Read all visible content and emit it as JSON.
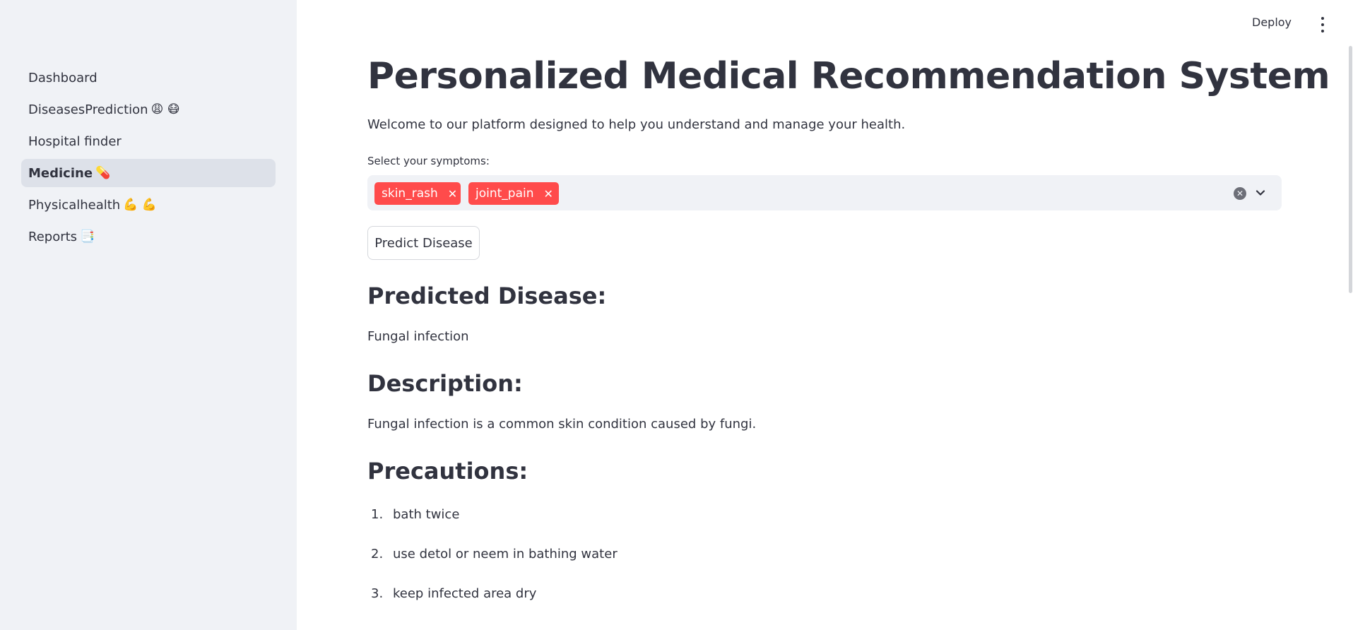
{
  "sidebar": {
    "items": [
      {
        "label": "Dashboard",
        "emoji": ""
      },
      {
        "label": "DiseasesPrediction",
        "emoji": "😩 😷"
      },
      {
        "label": "Hospital finder",
        "emoji": ""
      },
      {
        "label": "Medicine",
        "emoji": "💊"
      },
      {
        "label": "Physicalhealth",
        "emoji": "💪 💪"
      },
      {
        "label": "Reports",
        "emoji": "📑"
      }
    ],
    "active_index": 3
  },
  "header": {
    "deploy_label": "Deploy"
  },
  "main": {
    "title": "Personalized Medical Recommendation System",
    "welcome": "Welcome to our platform designed to help you understand and manage your health.",
    "select_label": "Select your symptoms:",
    "selected_symptoms": [
      "skin_rash",
      "joint_pain"
    ],
    "predict_button": "Predict Disease",
    "predicted_heading": "Predicted Disease:",
    "predicted_value": "Fungal infection",
    "description_heading": "Description:",
    "description_text": "Fungal infection is a common skin condition caused by fungi.",
    "precautions_heading": "Precautions:",
    "precautions": [
      {
        "num": "1.",
        "text": "bath twice"
      },
      {
        "num": "2.",
        "text": "use detol or neem in bathing water"
      },
      {
        "num": "3.",
        "text": "keep infected area dry"
      }
    ]
  },
  "colors": {
    "accent": "#ff4b4b",
    "sidebar_bg": "#f0f2f6",
    "text": "#31333f"
  }
}
